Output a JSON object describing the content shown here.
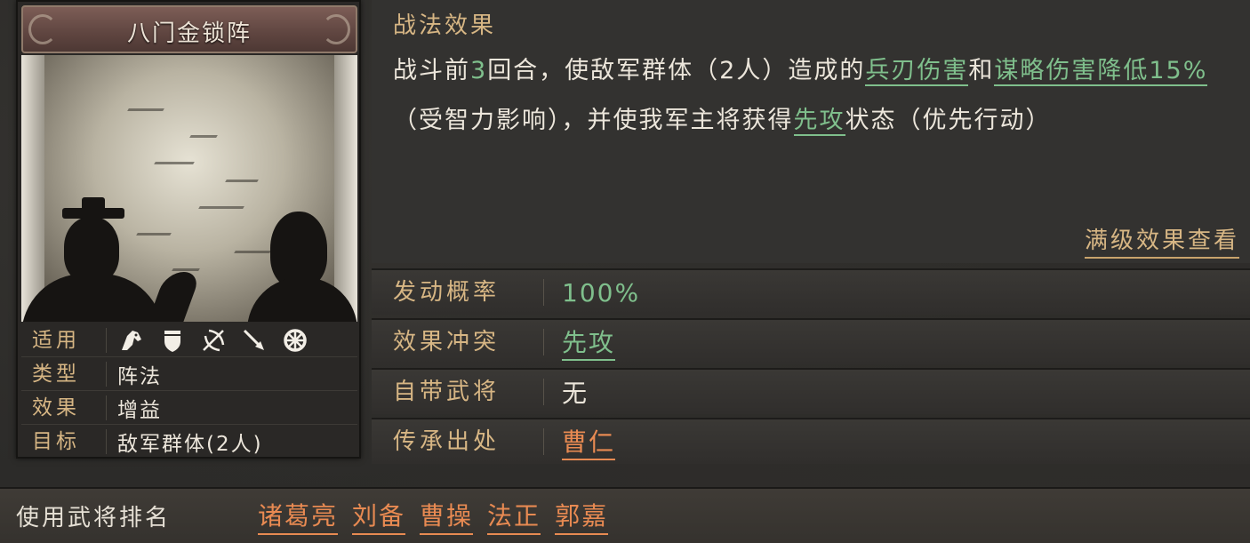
{
  "tactic": {
    "name": "八门金锁阵",
    "properties": [
      {
        "key": "适用",
        "value": ""
      },
      {
        "key": "类型",
        "value": "阵法"
      },
      {
        "key": "效果",
        "value": "增益"
      },
      {
        "key": "目标",
        "value": "敌军群体(2人)"
      }
    ],
    "applicable_icons": [
      "cavalry-icon",
      "shield-icon",
      "bow-icon",
      "spear-icon",
      "wheel-icon"
    ]
  },
  "effect": {
    "label": "战法效果",
    "segments": [
      {
        "text": "战斗前",
        "style": "plain"
      },
      {
        "text": "3",
        "style": "green"
      },
      {
        "text": "回合，使敌军群体（2人）造成的",
        "style": "plain"
      },
      {
        "text": "兵刃伤害",
        "style": "green-u"
      },
      {
        "text": "和",
        "style": "plain"
      },
      {
        "text": "谋略伤害降低15%",
        "style": "green-u"
      },
      {
        "text": "（受智力影响），并使我军主将获得",
        "style": "plain"
      },
      {
        "text": "先攻",
        "style": "green-u"
      },
      {
        "text": "状态（优先行动）",
        "style": "plain"
      }
    ],
    "full_level_button": "满级效果查看"
  },
  "attributes": [
    {
      "key": "发动概率",
      "value": "100%",
      "style": "green"
    },
    {
      "key": "效果冲突",
      "value": "先攻",
      "style": "green-u"
    },
    {
      "key": "自带武将",
      "value": "无",
      "style": "plain"
    },
    {
      "key": "传承出处",
      "value": "曹仁",
      "style": "orange-u"
    }
  ],
  "ranking": {
    "label": "使用武将排名",
    "generals": [
      "诸葛亮",
      "刘备",
      "曹操",
      "法正",
      "郭嘉"
    ]
  },
  "colors": {
    "accent_gold": "#d7b684",
    "highlight_green": "#7fbf8c",
    "highlight_orange": "#e88a52"
  }
}
